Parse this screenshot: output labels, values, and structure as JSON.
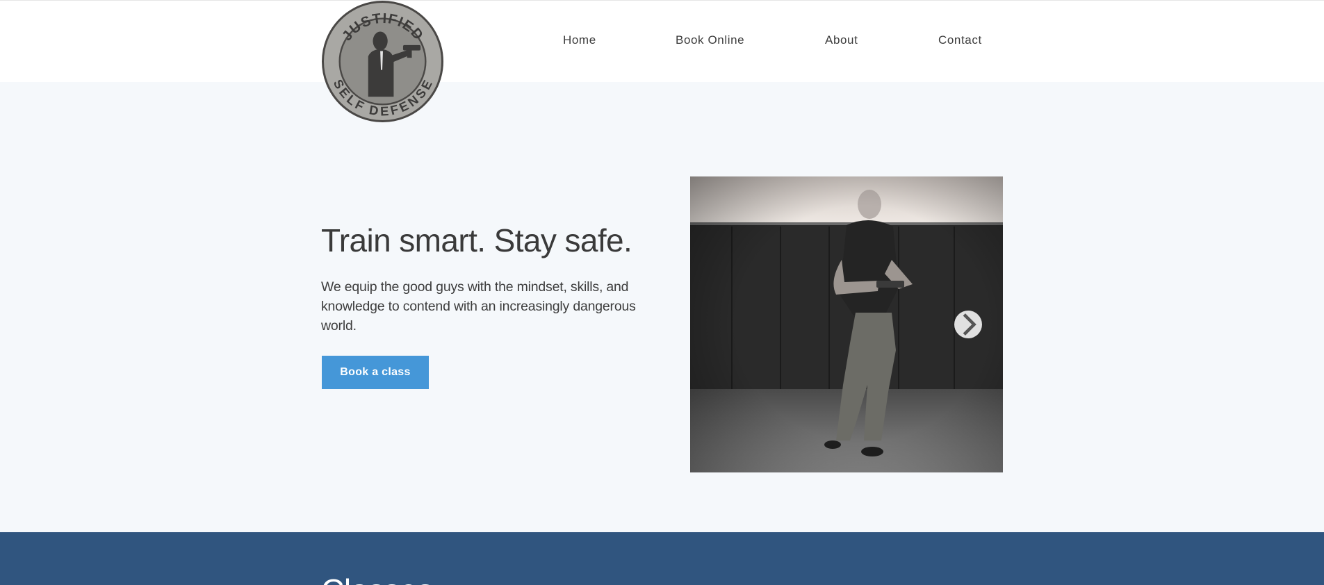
{
  "brand": {
    "logo_top_text": "JUSTIFIED",
    "logo_bottom_text": "SELF DEFENSE"
  },
  "nav": {
    "items": [
      {
        "label": "Home"
      },
      {
        "label": "Book Online"
      },
      {
        "label": "About"
      },
      {
        "label": "Contact"
      }
    ]
  },
  "hero": {
    "title": "Train smart. Stay safe.",
    "description": "We equip the good guys with the mindset, skills, and knowledge to contend with an increasingly dangerous world.",
    "cta_label": "Book a class"
  },
  "slideshow": {
    "next_icon": "chevron-right-icon"
  },
  "classes": {
    "title": "Classes"
  },
  "colors": {
    "header_bg": "#ffffff",
    "page_bg": "#f5f8fb",
    "cta_bg": "#4597d8",
    "classes_band_bg": "#30557f",
    "logo_fill": "#a9a8a4",
    "logo_ink": "#4a4846"
  }
}
